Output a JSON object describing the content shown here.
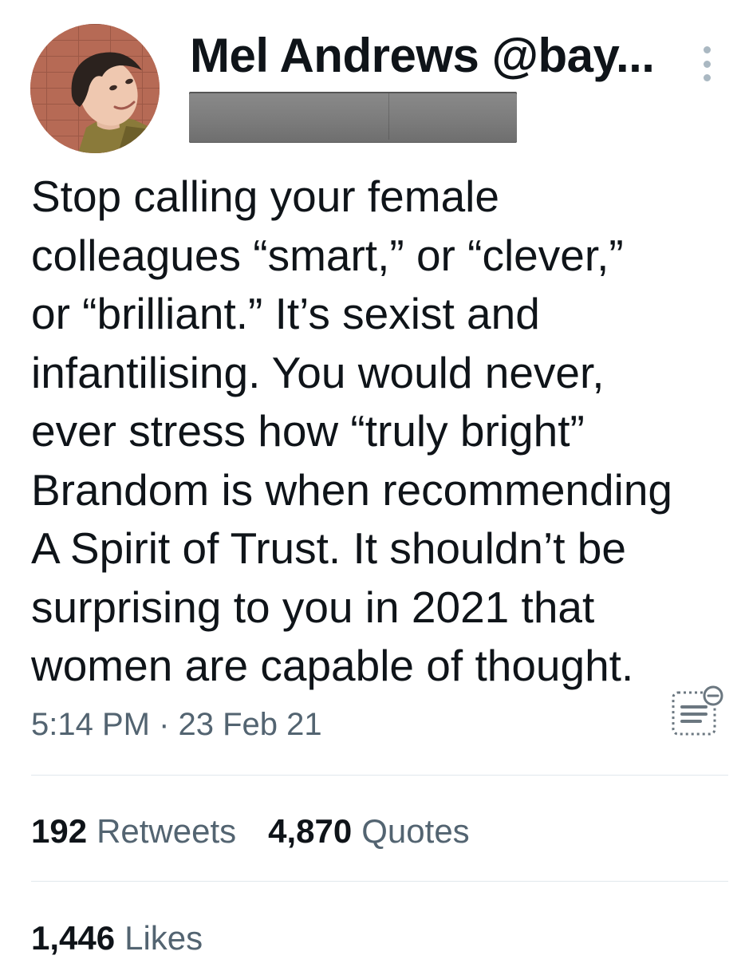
{
  "author": {
    "display_name_line": "Mel Andrews @bay...",
    "handle_redacted": true
  },
  "tweet": {
    "text": "Stop calling your female\ncolleagues “smart,” or “clever,”\nor “brilliant.” It’s sexist and\ninfantilising. You would never,\never stress how “truly bright”\nBrandom is when recommending\nA Spirit of Trust. It shouldn’t be\nsurprising to you in 2021 that\nwomen are capable of thought.",
    "timestamp": "5:14 PM · 23 Feb 21"
  },
  "stats": {
    "retweets_count": "192",
    "retweets_label": "Retweets",
    "quotes_count": "4,870",
    "quotes_label": "Quotes",
    "likes_count": "1,446",
    "likes_label": "Likes"
  },
  "icons": {
    "more": "more-vertical-icon",
    "notes": "notes-overlay-icon",
    "avatar": "avatar"
  },
  "colors": {
    "text_primary": "#0f1419",
    "text_secondary": "#536471",
    "divider": "#e1e8ed",
    "more_dots": "#aab8c2",
    "redaction_gray": "#7c7c7c"
  }
}
